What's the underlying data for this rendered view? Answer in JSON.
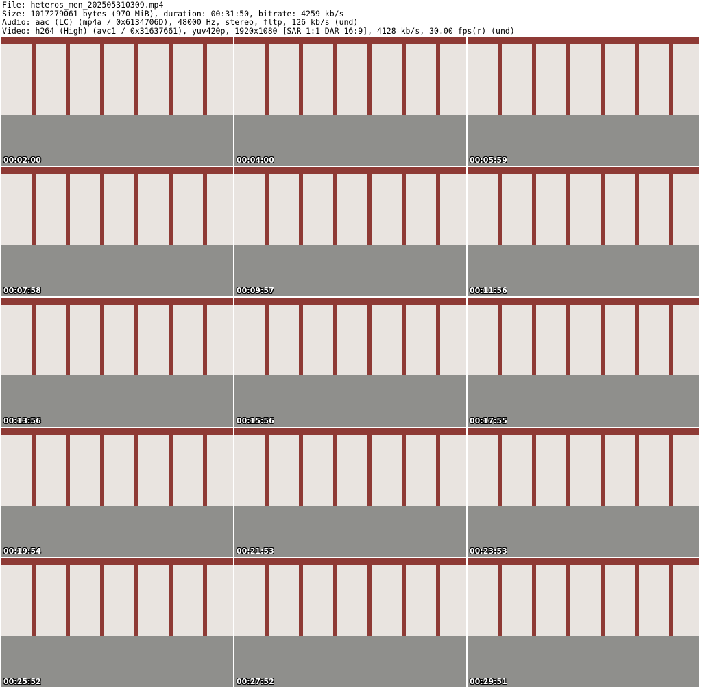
{
  "header": {
    "file": "File: heteros_men_202505310309.mp4",
    "size": "Size: 1017279061 bytes (970 MiB), duration: 00:31:50, bitrate: 4259 kb/s",
    "audio": "Audio: aac (LC) (mp4a / 0x6134706D), 48000 Hz, stereo, fltp, 126 kb/s (und)",
    "video": "Video: h264 (High) (avc1 / 0x31637661), yuv420p, 1920x1080 [SAR 1:1 DAR 16:9], 4128 kb/s, 30.00 fps(r) (und)"
  },
  "thumbnails": [
    {
      "time": "00:02:00"
    },
    {
      "time": "00:04:00"
    },
    {
      "time": "00:05:59"
    },
    {
      "time": "00:07:58"
    },
    {
      "time": "00:09:57"
    },
    {
      "time": "00:11:56"
    },
    {
      "time": "00:13:56"
    },
    {
      "time": "00:15:56"
    },
    {
      "time": "00:17:55"
    },
    {
      "time": "00:19:54"
    },
    {
      "time": "00:21:53"
    },
    {
      "time": "00:23:53"
    },
    {
      "time": "00:25:52"
    },
    {
      "time": "00:27:52"
    },
    {
      "time": "00:29:51"
    }
  ]
}
